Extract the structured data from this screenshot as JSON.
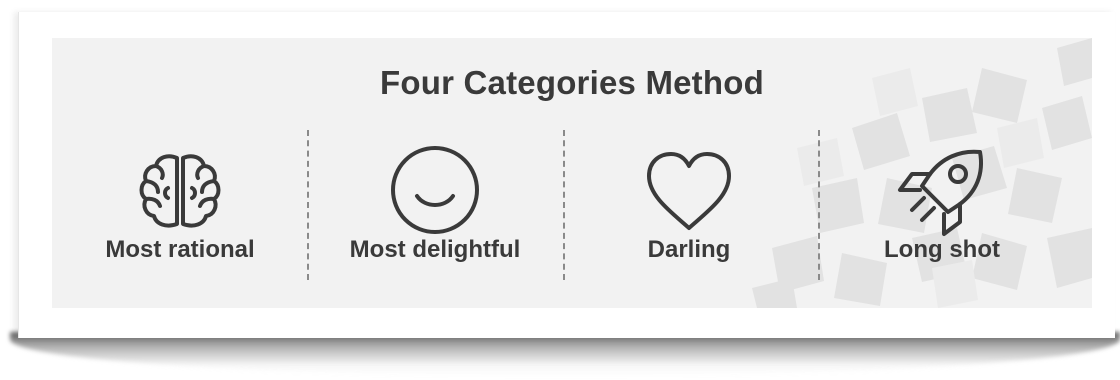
{
  "title": "Four Categories Method",
  "categories": [
    {
      "label": "Most rational",
      "icon": "brain-icon"
    },
    {
      "label": "Most delightful",
      "icon": "smile-icon"
    },
    {
      "label": "Darling",
      "icon": "heart-icon"
    },
    {
      "label": "Long shot",
      "icon": "rocket-icon"
    }
  ],
  "colors": {
    "text": "#3a3a3a",
    "panel": "#f2f2f2",
    "decoration": "#e4e4e4"
  }
}
